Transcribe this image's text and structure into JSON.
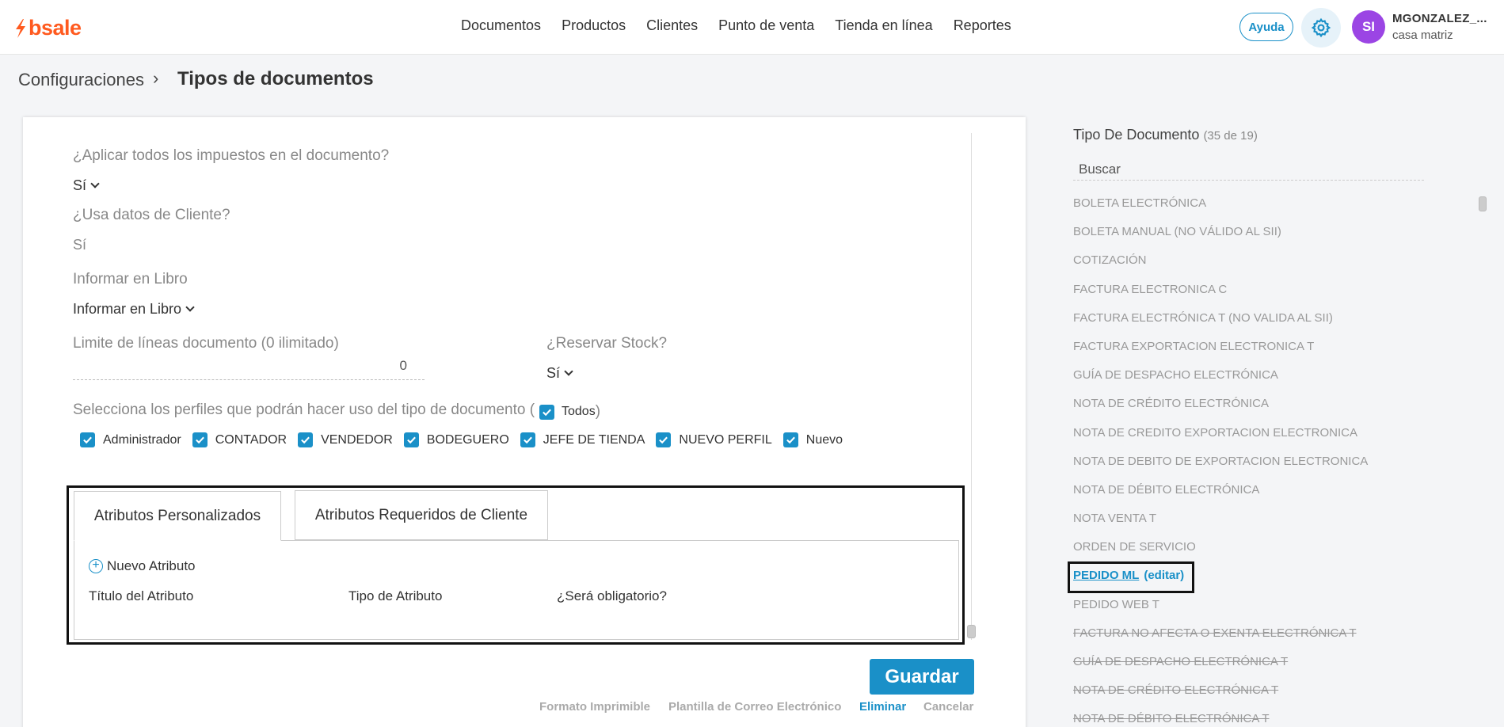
{
  "brand": {
    "name": "bsale",
    "color": "#ff5a1f"
  },
  "nav": [
    "Documentos",
    "Productos",
    "Clientes",
    "Punto de venta",
    "Tienda en línea",
    "Reportes"
  ],
  "header": {
    "help_label": "Ayuda",
    "settings_icon": "gear-icon",
    "avatar_initials": "SI",
    "user_name": "MGONZALEZ_...",
    "branch": "casa matriz"
  },
  "breadcrumb": {
    "root": "Configuraciones",
    "separator": "›",
    "current": "Tipos de documentos"
  },
  "form": {
    "taxes_label": "¿Aplicar todos los impuestos en el documento?",
    "taxes_value": "Sí",
    "client_data_label": "¿Usa datos de Cliente?",
    "client_data_value": "Sí",
    "book_label": "Informar en Libro",
    "book_value": "Informar en Libro",
    "line_limit_label": "Limite de líneas documento (0 ilimitado)",
    "line_limit_value": "0",
    "stock_label": "¿Reservar Stock?",
    "stock_value": "Sí",
    "profiles_label": "Selecciona los perfiles que podrán hacer uso del tipo de documento (",
    "all_label": "Todos",
    "all_close": ")",
    "profiles": [
      "Administrador",
      "CONTADOR",
      "VENDEDOR",
      "BODEGUERO",
      "JEFE DE TIENDA",
      "NUEVO PERFIL",
      "Nuevo"
    ]
  },
  "tabs": {
    "custom_label": "Atributos Personalizados",
    "required_label": "Atributos Requeridos de Cliente",
    "new_attribute_label": "Nuevo Atributo",
    "columns": [
      "Título del Atributo",
      "Tipo de Atributo",
      "¿Será obligatorio?"
    ]
  },
  "actions": {
    "save_label": "Guardar",
    "print_format": "Formato Imprimible",
    "email_template": "Plantilla de Correo Electrónico",
    "delete": "Eliminar",
    "cancel": "Cancelar"
  },
  "doc_types": {
    "title": "Tipo De Documento",
    "count": "(35 de 19)",
    "search_placeholder": "Buscar",
    "edit_label": "(editar)",
    "items": [
      {
        "name": "BOLETA ELECTRÓNICA",
        "state": "normal"
      },
      {
        "name": "BOLETA MANUAL (NO VÁLIDO AL SII)",
        "state": "normal"
      },
      {
        "name": "COTIZACIÓN",
        "state": "normal"
      },
      {
        "name": "FACTURA ELECTRONICA C",
        "state": "normal"
      },
      {
        "name": "FACTURA ELECTRÓNICA T (NO VALIDA AL SII)",
        "state": "normal"
      },
      {
        "name": "FACTURA EXPORTACION ELECTRONICA T",
        "state": "normal"
      },
      {
        "name": "GUÍA DE DESPACHO ELECTRÓNICA",
        "state": "normal"
      },
      {
        "name": "NOTA DE CRÉDITO ELECTRÓNICA",
        "state": "normal"
      },
      {
        "name": "NOTA DE CREDITO EXPORTACION ELECTRONICA",
        "state": "normal"
      },
      {
        "name": "NOTA DE DEBITO DE EXPORTACION ELECTRONICA",
        "state": "normal"
      },
      {
        "name": "NOTA DE DÉBITO ELECTRÓNICA",
        "state": "normal"
      },
      {
        "name": "NOTA VENTA T",
        "state": "normal"
      },
      {
        "name": "ORDEN DE SERVICIO",
        "state": "normal"
      },
      {
        "name": "PEDIDO ML",
        "state": "selected"
      },
      {
        "name": "PEDIDO WEB T",
        "state": "normal"
      },
      {
        "name": "FACTURA NO AFECTA O EXENTA ELECTRÓNICA T",
        "state": "disabled"
      },
      {
        "name": "GUÍA DE DESPACHO ELECTRÓNICA T",
        "state": "disabled"
      },
      {
        "name": "NOTA DE CRÉDITO ELECTRÓNICA T",
        "state": "disabled"
      },
      {
        "name": "NOTA DE DÉBITO ELECTRÓNICA T",
        "state": "disabled"
      }
    ]
  },
  "colors": {
    "accent": "#1a90c8",
    "avatar": "#9b45e4"
  }
}
